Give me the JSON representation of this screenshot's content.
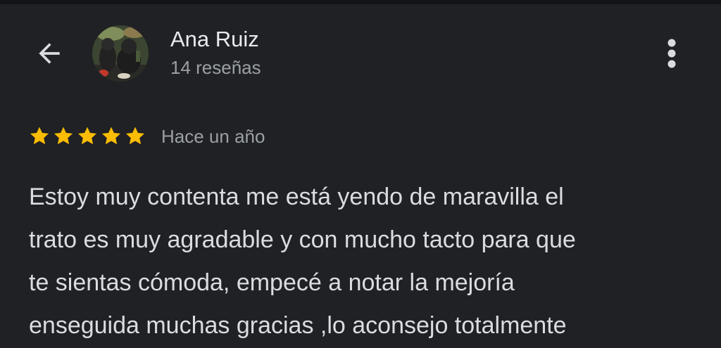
{
  "reviewer": {
    "name": "Ana Ruiz",
    "meta": "14 reseñas",
    "avatar": "profile-photo"
  },
  "toolbar": {
    "back_icon": "arrow-back-icon",
    "more_icon": "more-vert-icon"
  },
  "review": {
    "rating": 5,
    "rating_max": 5,
    "date": "Hace un año",
    "text_lines": [
      "Estoy muy contenta me está yendo de maravilla el",
      "trato es muy agradable y con mucho tacto para que",
      "te sientas cómoda, empecé a notar la mejoría",
      "enseguida muchas gracias ,lo aconsejo totalmente"
    ]
  },
  "colors": {
    "background": "#202124",
    "star": "#fbbc04",
    "primary_text": "#e8eaed",
    "secondary_text": "#9aa0a6"
  }
}
